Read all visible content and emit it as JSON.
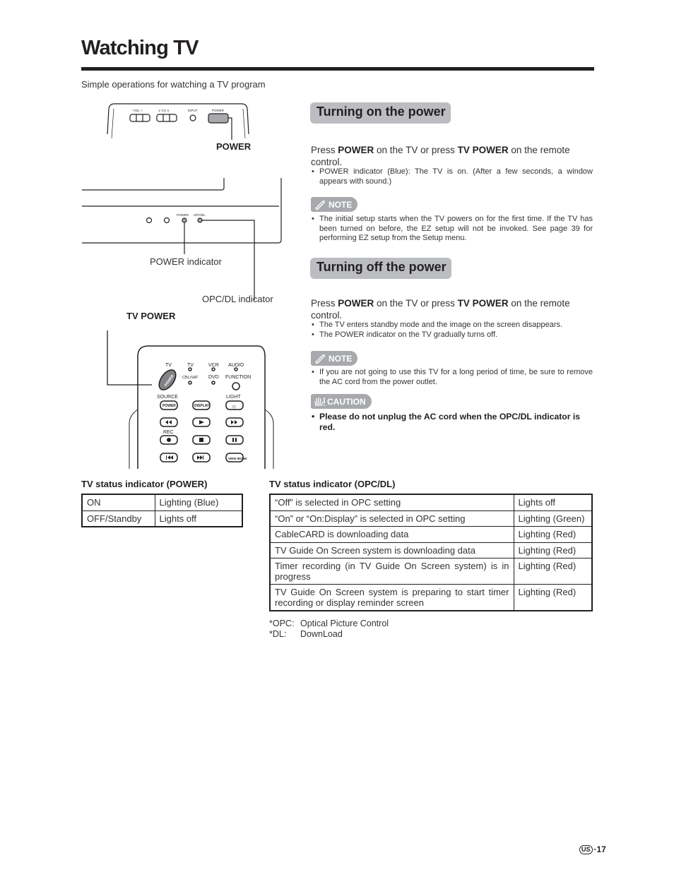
{
  "page": {
    "title": "Watching TV",
    "subtitle": "Simple operations for watching a TV program",
    "page_region": "US",
    "page_number": "·17"
  },
  "diagram": {
    "tv_top_buttons": [
      "- VOL +",
      "∨ CH ∧",
      "INPUT",
      "POWER"
    ],
    "power_label": "POWER",
    "front_panel_labels": [
      "POWER",
      "OPC/DL"
    ],
    "power_indicator_label": "POWER indicator",
    "opc_indicator_label": "OPC/DL indicator",
    "tv_power_label": "TV POWER",
    "remote": {
      "tv_label": "TV",
      "power_button": "POWER",
      "mode_labels": [
        "TV",
        "VCR",
        "AUDIO",
        "CBL/SAT",
        "DVD",
        "FUNCTION"
      ],
      "source_label": "SOURCE",
      "source_power": "POWER",
      "display": "DISPLAY",
      "light_label": "LIGHT",
      "rec_label": "REC",
      "view_mode": "VIEW MODE"
    }
  },
  "turning_on": {
    "heading": "Turning on the power",
    "lead_parts": [
      "Press ",
      "POWER",
      " on the TV or press ",
      "TV POWER",
      " on the remote control."
    ],
    "bullets": [
      "POWER indicator (Blue): The TV is on. (After a few seconds, a window appears with sound.)"
    ],
    "note_label": "NOTE",
    "note_bullets": [
      "The initial setup starts when the TV powers on for the first time. If the TV has been turned on before, the EZ setup will not be invoked. See page 39 for performing EZ setup from the Setup menu."
    ]
  },
  "turning_off": {
    "heading": "Turning off the power",
    "lead_parts": [
      "Press ",
      "POWER",
      " on the TV or press ",
      "TV POWER",
      " on the remote control."
    ],
    "bullets": [
      "The TV enters standby mode and the image on the screen disappears.",
      "The POWER indicator on the TV gradually turns off."
    ],
    "note_label": "NOTE",
    "note_bullets": [
      "If you are not going to use this TV for a long period of time, be sure to remove the AC cord from the power outlet."
    ],
    "caution_label": "CAUTION",
    "caution_bullets": [
      "Please do not unplug the AC cord when the OPC/DL indicator is red."
    ]
  },
  "power_table": {
    "title": "TV status indicator (POWER)",
    "rows": [
      [
        "ON",
        "Lighting (Blue)"
      ],
      [
        "OFF/Standby",
        "Lights off"
      ]
    ]
  },
  "opc_table": {
    "title": "TV status indicator (OPC/DL)",
    "rows": [
      [
        "“Off” is selected in OPC setting",
        "Lights off"
      ],
      [
        "“On” or “On:Display” is selected in OPC setting",
        "Lighting (Green)"
      ],
      [
        "CableCARD is downloading data",
        "Lighting (Red)"
      ],
      [
        "TV Guide On Screen system is downloading data",
        "Lighting (Red)"
      ],
      [
        "Timer recording (in TV Guide On Screen system) is in progress",
        "Lighting (Red)"
      ],
      [
        "TV Guide On Screen system is preparing to start timer recording or display reminder screen",
        "Lighting (Red)"
      ]
    ],
    "footnotes": [
      [
        "*OPC:",
        "Optical Picture Control"
      ],
      [
        "*DL:",
        "DownLoad"
      ]
    ]
  },
  "colors": {
    "heading_bg": "#bcbdc0",
    "badge_bg": "#a7a9ac",
    "text": "#231f20"
  }
}
